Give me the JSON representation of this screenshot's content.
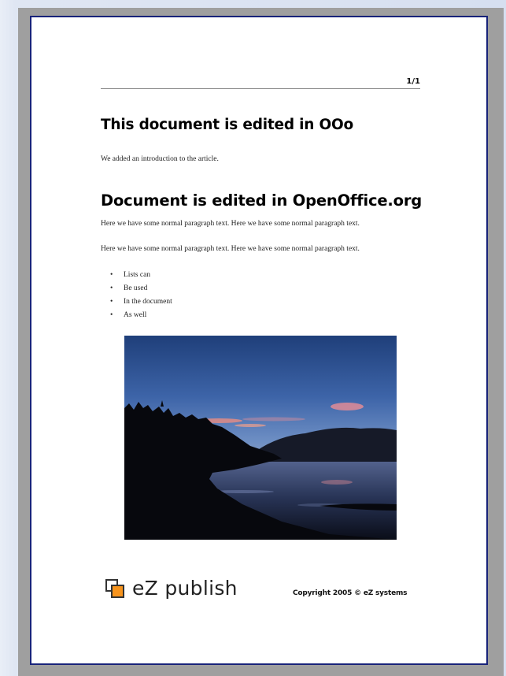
{
  "document": {
    "page_number": "1/1",
    "heading1": "This document is edited in OOo",
    "intro": "We added an introduction to the article.",
    "heading2": "Document is edited in OpenOffice.org",
    "paragraphs": [
      "Here we have some normal paragraph text. Here we have some normal paragraph text.",
      "Here we have some normal paragraph text. Here we have some normal paragraph text."
    ],
    "bullet_symbol": "•",
    "list": [
      "Lists can",
      "Be used",
      "In the document",
      "As well"
    ],
    "image": {
      "subject": "sunset over lake silhouette photo"
    }
  },
  "footer": {
    "logo_text": "eZ publish",
    "logo_icon": "ez-logo-icon",
    "copyright": "Copyright 2005 © eZ systems"
  },
  "colors": {
    "page_border": "#18237a",
    "backdrop": "#9f9f9f",
    "logo_orange": "#f7941d"
  }
}
